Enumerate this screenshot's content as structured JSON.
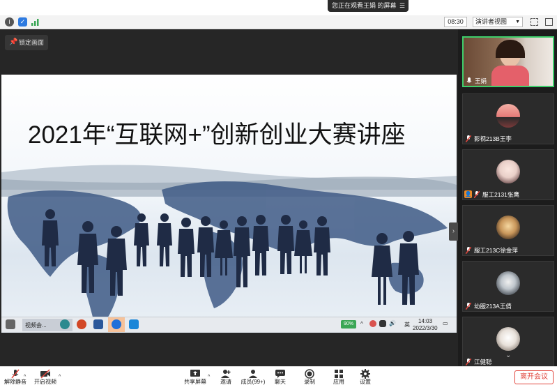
{
  "banner": {
    "text": "您正在观看王娟 的屏幕",
    "menu_icon": "menu-icon"
  },
  "toolbar": {
    "time": "08:30",
    "view_label": "演讲者视图",
    "icons": [
      "info-icon",
      "shield-icon",
      "signal-icon",
      "fullscreen-icon",
      "sidebar-toggle-icon"
    ]
  },
  "stage": {
    "lock_label": "锁定画面",
    "slide_title": "2021年“互联网+”创新创业大赛讲座",
    "taskbar": {
      "app_label": "视频会...",
      "battery": "90%",
      "ime": "英",
      "time": "14:03",
      "date": "2022/3/30"
    }
  },
  "participants": [
    {
      "name": "王娟",
      "muted": false,
      "active": true
    },
    {
      "name": "影视213B王李",
      "muted": true
    },
    {
      "name": "服工2131张鹰",
      "muted": true,
      "host_badge": true
    },
    {
      "name": "服工213C徐金萍",
      "muted": true
    },
    {
      "name": "幼服213A王倩",
      "muted": true
    },
    {
      "name": "江健聪",
      "muted": true
    }
  ],
  "bottombar": {
    "items": [
      {
        "label": "解除静音",
        "icon": "mic-muted-icon"
      },
      {
        "label": "开启视频",
        "icon": "video-off-icon"
      },
      {
        "label": "共享屏幕",
        "icon": "share-screen-icon"
      },
      {
        "label": "邀请",
        "icon": "invite-icon"
      },
      {
        "label": "成员(99+)",
        "icon": "members-icon"
      },
      {
        "label": "聊天",
        "icon": "chat-icon"
      },
      {
        "label": "录制",
        "icon": "record-icon"
      },
      {
        "label": "应用",
        "icon": "apps-icon"
      },
      {
        "label": "设置",
        "icon": "settings-icon"
      }
    ],
    "leave_label": "离开会议"
  },
  "colors": {
    "active_border": "#3ecf6b",
    "leave": "#e1453c",
    "host_badge": "#f08a24"
  }
}
